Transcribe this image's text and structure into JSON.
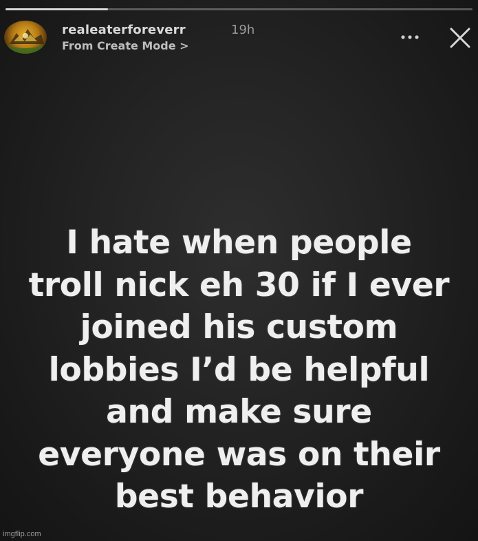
{
  "story": {
    "progress_fraction": 0.22,
    "header": {
      "username": "realeaterforeverr",
      "timestamp": "19h",
      "source_link": "From Create Mode >"
    },
    "text_lines": [
      "I hate when people",
      "troll nick eh 30 if I ever",
      "joined his custom",
      "lobbies I’d be helpful",
      "and make sure",
      "everyone was on their",
      "best behavior"
    ]
  },
  "icons": {
    "more": "more-options-icon",
    "close": "close-icon"
  },
  "watermark": "imgflip.com",
  "colors": {
    "background": "#1b1b1b",
    "text": "#efefef",
    "muted": "#9a9a9a"
  }
}
